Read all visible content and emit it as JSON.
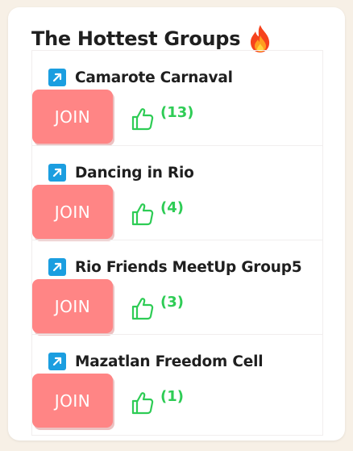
{
  "widget": {
    "title": "The Hottest Groups",
    "title_icon": "fire-emoji"
  },
  "groups": [
    {
      "name": "Camarote Carnaval",
      "join_label": "JOIN",
      "likes": "(13)"
    },
    {
      "name": "Dancing in Rio",
      "join_label": "JOIN",
      "likes": "(4)"
    },
    {
      "name": "Rio Friends MeetUp Group5",
      "join_label": "JOIN",
      "likes": "(3)"
    },
    {
      "name": "Mazatlan Freedom Cell",
      "join_label": "JOIN",
      "likes": "(1)"
    }
  ],
  "colors": {
    "background": "#f7f0e6",
    "join_button": "#ff8585",
    "link_icon": "#1b9ee0",
    "likes": "#2ecc55"
  }
}
